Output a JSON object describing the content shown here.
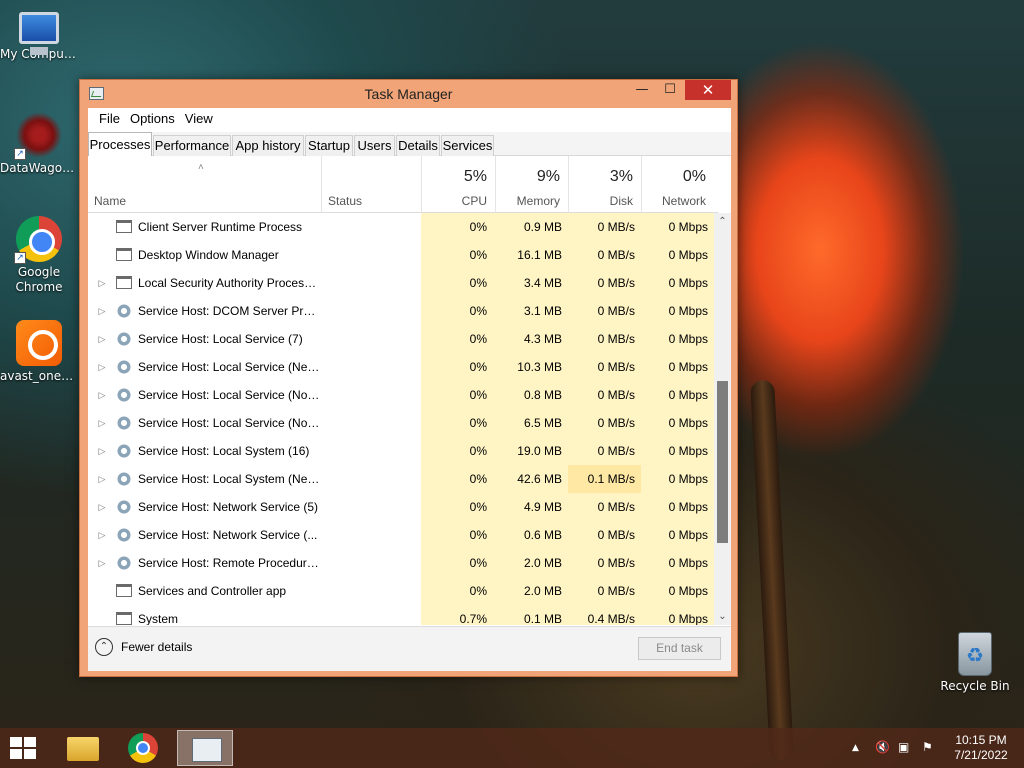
{
  "desktop": {
    "icons": [
      {
        "label": "My Computer"
      },
      {
        "label": "DataWagon..."
      },
      {
        "label": "Google Chrome"
      },
      {
        "label": "avast_one_e..."
      },
      {
        "label": "Recycle Bin"
      }
    ]
  },
  "window": {
    "title": "Task Manager",
    "minimize": "—",
    "maximize": "☐",
    "close": "✕"
  },
  "menu": [
    "File",
    "Options",
    "View"
  ],
  "tabs": [
    "Processes",
    "Performance",
    "App history",
    "Startup",
    "Users",
    "Details",
    "Services"
  ],
  "columns": {
    "name": "Name",
    "status": "Status",
    "cpu": {
      "pct": "5%",
      "label": "CPU"
    },
    "memory": {
      "pct": "9%",
      "label": "Memory"
    },
    "disk": {
      "pct": "3%",
      "label": "Disk"
    },
    "network": {
      "pct": "0%",
      "label": "Network"
    }
  },
  "rows": [
    {
      "expand": "",
      "icon": "window",
      "name": "Client Server Runtime Process",
      "cpu": "0%",
      "mem": "0.9 MB",
      "disk": "0 MB/s",
      "net": "0 Mbps"
    },
    {
      "expand": "",
      "icon": "window",
      "name": "Desktop Window Manager",
      "cpu": "0%",
      "mem": "16.1 MB",
      "disk": "0 MB/s",
      "net": "0 Mbps"
    },
    {
      "expand": "▷",
      "icon": "window",
      "name": "Local Security Authority Process...",
      "cpu": "0%",
      "mem": "3.4 MB",
      "disk": "0 MB/s",
      "net": "0 Mbps"
    },
    {
      "expand": "▷",
      "icon": "gear",
      "name": "Service Host: DCOM Server Proc...",
      "cpu": "0%",
      "mem": "3.1 MB",
      "disk": "0 MB/s",
      "net": "0 Mbps"
    },
    {
      "expand": "▷",
      "icon": "gear",
      "name": "Service Host: Local Service (7)",
      "cpu": "0%",
      "mem": "4.3 MB",
      "disk": "0 MB/s",
      "net": "0 Mbps"
    },
    {
      "expand": "▷",
      "icon": "gear",
      "name": "Service Host: Local Service (Net...",
      "cpu": "0%",
      "mem": "10.3 MB",
      "disk": "0 MB/s",
      "net": "0 Mbps"
    },
    {
      "expand": "▷",
      "icon": "gear",
      "name": "Service Host: Local Service (No I...",
      "cpu": "0%",
      "mem": "0.8 MB",
      "disk": "0 MB/s",
      "net": "0 Mbps"
    },
    {
      "expand": "▷",
      "icon": "gear",
      "name": "Service Host: Local Service (No ...",
      "cpu": "0%",
      "mem": "6.5 MB",
      "disk": "0 MB/s",
      "net": "0 Mbps"
    },
    {
      "expand": "▷",
      "icon": "gear",
      "name": "Service Host: Local System (16)",
      "cpu": "0%",
      "mem": "19.0 MB",
      "disk": "0 MB/s",
      "net": "0 Mbps"
    },
    {
      "expand": "▷",
      "icon": "gear",
      "name": "Service Host: Local System (Net...",
      "cpu": "0%",
      "mem": "42.6 MB",
      "disk": "0.1 MB/s",
      "net": "0 Mbps",
      "disk_hot": true
    },
    {
      "expand": "▷",
      "icon": "gear",
      "name": "Service Host: Network Service (5)",
      "cpu": "0%",
      "mem": "4.9 MB",
      "disk": "0 MB/s",
      "net": "0 Mbps"
    },
    {
      "expand": "▷",
      "icon": "gear",
      "name": "Service Host: Network Service (...",
      "cpu": "0%",
      "mem": "0.6 MB",
      "disk": "0 MB/s",
      "net": "0 Mbps"
    },
    {
      "expand": "▷",
      "icon": "gear",
      "name": "Service Host: Remote Procedure...",
      "cpu": "0%",
      "mem": "2.0 MB",
      "disk": "0 MB/s",
      "net": "0 Mbps"
    },
    {
      "expand": "",
      "icon": "window",
      "name": "Services and Controller app",
      "cpu": "0%",
      "mem": "2.0 MB",
      "disk": "0 MB/s",
      "net": "0 Mbps"
    },
    {
      "expand": "",
      "icon": "window",
      "name": "System",
      "cpu": "0.7%",
      "mem": "0.1 MB",
      "disk": "0.4 MB/s",
      "net": "0 Mbps"
    }
  ],
  "footer": {
    "fewer_details": "Fewer details",
    "end_task": "End task"
  },
  "taskbar": {
    "time": "10:15 PM",
    "date": "7/21/2022"
  }
}
